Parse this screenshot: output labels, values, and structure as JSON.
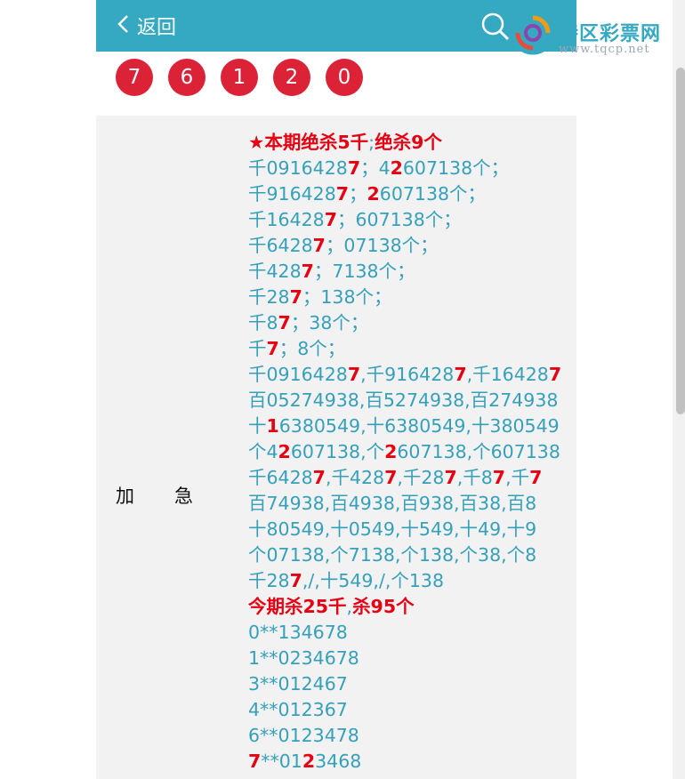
{
  "header": {
    "back_label": "返回"
  },
  "brand": {
    "title": "特区彩票网",
    "url": "www.tqcp.net"
  },
  "balls": [
    "7",
    "6",
    "1",
    "2",
    "0"
  ],
  "row": {
    "label_a": "加",
    "label_b": "急"
  },
  "content_lines": [
    [
      [
        "★本期绝杀5千",
        true
      ],
      [
        ";",
        false
      ],
      [
        "绝杀9个",
        true
      ]
    ],
    [
      [
        "千091642",
        false
      ],
      [
        "8",
        false
      ],
      [
        "7",
        true
      ],
      [
        "；4",
        false
      ],
      [
        "2",
        true
      ],
      [
        "607138个；",
        false
      ]
    ],
    [
      [
        "千916428",
        false
      ],
      [
        "7",
        true
      ],
      [
        "；",
        false
      ],
      [
        "2",
        true
      ],
      [
        "607138个；",
        false
      ]
    ],
    [
      [
        "千16428",
        false
      ],
      [
        "7",
        true
      ],
      [
        "；607138个；",
        false
      ]
    ],
    [
      [
        "千6428",
        false
      ],
      [
        "7",
        true
      ],
      [
        "；07138个；",
        false
      ]
    ],
    [
      [
        "千428",
        false
      ],
      [
        "7",
        true
      ],
      [
        "；7138个；",
        false
      ]
    ],
    [
      [
        "千28",
        false
      ],
      [
        "7",
        true
      ],
      [
        "；138个；",
        false
      ]
    ],
    [
      [
        "千8",
        false
      ],
      [
        "7",
        true
      ],
      [
        "；38个；",
        false
      ]
    ],
    [
      [
        "千",
        false
      ],
      [
        "7",
        true
      ],
      [
        "；8个；",
        false
      ]
    ],
    [
      [
        "千0916428",
        false
      ],
      [
        "7",
        true
      ],
      [
        ",千916428",
        false
      ],
      [
        "7",
        true
      ],
      [
        ",千16428",
        false
      ],
      [
        "7",
        true
      ]
    ],
    [
      [
        "百05274938,百5274938,百274938",
        false
      ]
    ],
    [
      [
        "十",
        false
      ],
      [
        "1",
        true
      ],
      [
        "6380549,十6380549,十380549",
        false
      ]
    ],
    [
      [
        "个4",
        false
      ],
      [
        "2",
        true
      ],
      [
        "607138,个",
        false
      ],
      [
        "2",
        true
      ],
      [
        "607138,个607138",
        false
      ]
    ],
    [
      [
        "千6428",
        false
      ],
      [
        "7",
        true
      ],
      [
        ",千428",
        false
      ],
      [
        "7",
        true
      ],
      [
        ",千28",
        false
      ],
      [
        "7",
        true
      ],
      [
        ",千8",
        false
      ],
      [
        "7",
        true
      ],
      [
        ",千",
        false
      ],
      [
        "7",
        true
      ]
    ],
    [
      [
        "百74938,百4938,百938,百38,百8",
        false
      ]
    ],
    [
      [
        "十80549,十0549,十549,十49,十9",
        false
      ]
    ],
    [
      [
        "个07138,个7138,个138,个38,个8",
        false
      ]
    ],
    [
      [
        "千28",
        false
      ],
      [
        "7",
        true
      ],
      [
        ",/,十549,/,个138",
        false
      ]
    ],
    [
      [
        "今期杀25千",
        true
      ],
      [
        ",",
        false
      ],
      [
        "杀95个",
        true
      ]
    ],
    [
      [
        "0**134678",
        false
      ]
    ],
    [
      [
        "1**0234678",
        false
      ]
    ],
    [
      [
        "3**012467",
        false
      ]
    ],
    [
      [
        "4**012367",
        false
      ]
    ],
    [
      [
        "6**0123478",
        false
      ]
    ],
    [
      [
        "7",
        true
      ],
      [
        "**01",
        false
      ],
      [
        "2",
        true
      ],
      [
        "3468",
        false
      ]
    ]
  ],
  "colors": {
    "header_bg": "#36a9c2",
    "ball_bg": "#dc2237",
    "highlight": "#e60012",
    "text": "#36a0bb",
    "panel_bg": "#f2f2f2"
  }
}
